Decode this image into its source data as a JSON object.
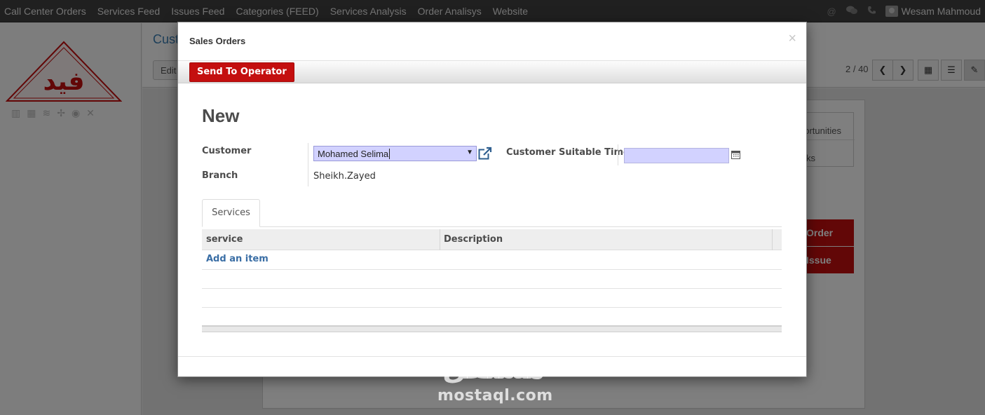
{
  "navbar": {
    "menu": [
      "Call Center Orders",
      "Services Feed",
      "Issues Feed",
      "Categories (FEED)",
      "Services Analysis",
      "Order Analisys",
      "Website"
    ],
    "icons": [
      "at-icon",
      "chat-icon",
      "phone-icon"
    ],
    "user_name": "Wesam Mahmoud"
  },
  "background": {
    "breadcrumb": "Cust",
    "edit_label": "Edit",
    "pager": "2 / 40",
    "smart_button_1": "portunities",
    "smart_button_2": "ks",
    "red_button_1": "Order",
    "red_button_2": "Issue",
    "logo_text": "فيد"
  },
  "dialog": {
    "title": "Sales Orders",
    "close": "×",
    "send_button": "Send To Operator",
    "form_title": "New",
    "customer_label": "Customer",
    "customer_value": "Mohamed Selima",
    "branch_label": "Branch",
    "branch_value": "Sheikh.Zayed",
    "suitable_time_label": "Customer Suitable Time",
    "suitable_time_value": "",
    "tab_label": "Services",
    "columns": [
      "service",
      "Description"
    ],
    "add_item": "Add an item"
  },
  "watermark": {
    "arabic": "مستقل",
    "latin": "mostaql.com"
  },
  "colors": {
    "accent_red": "#c40f0f",
    "link_blue": "#3a6ea5",
    "required_field": "#d2d2ff"
  }
}
